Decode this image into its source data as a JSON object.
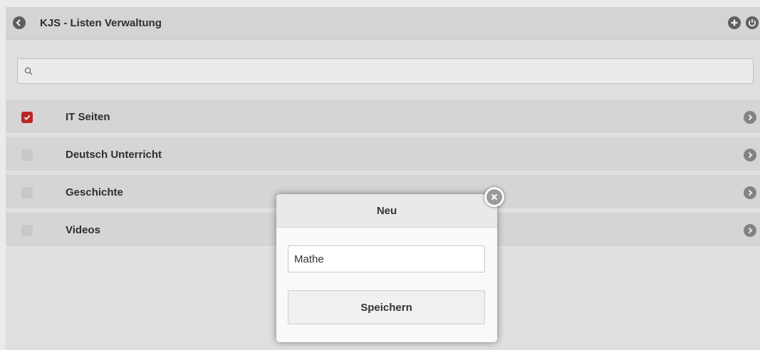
{
  "header": {
    "title": "KJS - Listen Verwaltung",
    "back_icon": "back-arrow-icon",
    "add_icon": "plus-icon",
    "power_icon": "power-icon"
  },
  "search": {
    "placeholder": "",
    "icon": "search-icon"
  },
  "lists": [
    {
      "label": "IT Seiten",
      "checked": true
    },
    {
      "label": "Deutsch Unterricht",
      "checked": false
    },
    {
      "label": "Geschichte",
      "checked": false
    },
    {
      "label": "Videos",
      "checked": false
    }
  ],
  "dialog": {
    "title": "Neu",
    "input_value": "Mathe",
    "save_label": "Speichern",
    "close_icon": "close-icon"
  },
  "colors": {
    "accent_red": "#cc2929",
    "header_bg": "#e6e6e6",
    "row_bg": "#e8e8e8"
  }
}
